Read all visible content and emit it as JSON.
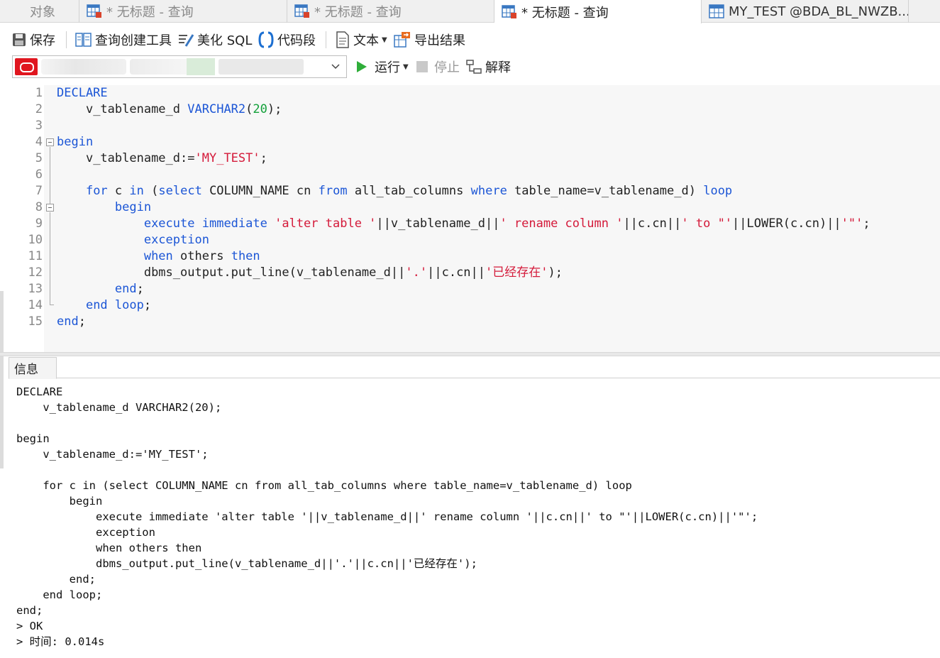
{
  "tabs": {
    "objects": "对象",
    "items": [
      {
        "label": "* 无标题 - 查询",
        "active": false
      },
      {
        "label": "* 无标题 - 查询",
        "active": false
      },
      {
        "label": "* 无标题 - 查询",
        "active": true
      },
      {
        "label": "MY_TEST @BDA_BL_NWZB...",
        "active": false
      }
    ]
  },
  "toolbar": {
    "save": "保存",
    "query_builder": "查询创建工具",
    "beautify_sql": "美化 SQL",
    "code_snippet": "代码段",
    "text": "文本",
    "export_results": "导出结果",
    "run": "运行",
    "stop": "停止",
    "explain": "解释"
  },
  "connection": {
    "value": "",
    "logo_color": "#e0161f"
  },
  "editor": {
    "line_numbers": [
      "1",
      "2",
      "3",
      "4",
      "5",
      "6",
      "7",
      "8",
      "9",
      "10",
      "11",
      "12",
      "13",
      "14",
      "15"
    ],
    "lines": [
      "DECLARE",
      "    v_tablename_d VARCHAR2(20);",
      "",
      "begin",
      "    v_tablename_d:='MY_TEST';",
      "",
      "    for c in (select COLUMN_NAME cn from all_tab_columns where table_name=v_tablename_d) loop",
      "        begin",
      "            execute immediate 'alter table '||v_tablename_d||' rename column '||c.cn||' to \"'||LOWER(c.cn)||'\"';",
      "            exception",
      "            when others then",
      "            dbms_output.put_line(v_tablename_d||'.'||c.cn||'已经存在');",
      "        end;",
      "    end loop;",
      "end;"
    ],
    "keyword_color": "#1c56d6",
    "string_color": "#d41a3a",
    "number_color": "#13a13a"
  },
  "result": {
    "tab_label": "信息",
    "lines": [
      "DECLARE",
      "    v_tablename_d VARCHAR2(20);",
      "",
      "begin",
      "    v_tablename_d:='MY_TEST';",
      "",
      "    for c in (select COLUMN_NAME cn from all_tab_columns where table_name=v_tablename_d) loop",
      "        begin",
      "            execute immediate 'alter table '||v_tablename_d||' rename column '||c.cn||' to \"'||LOWER(c.cn)||'\"';",
      "            exception",
      "            when others then",
      "            dbms_output.put_line(v_tablename_d||'.'||c.cn||'已经存在');",
      "        end;",
      "    end loop;",
      "end;",
      "> OK",
      "> 时间: 0.014s"
    ]
  }
}
